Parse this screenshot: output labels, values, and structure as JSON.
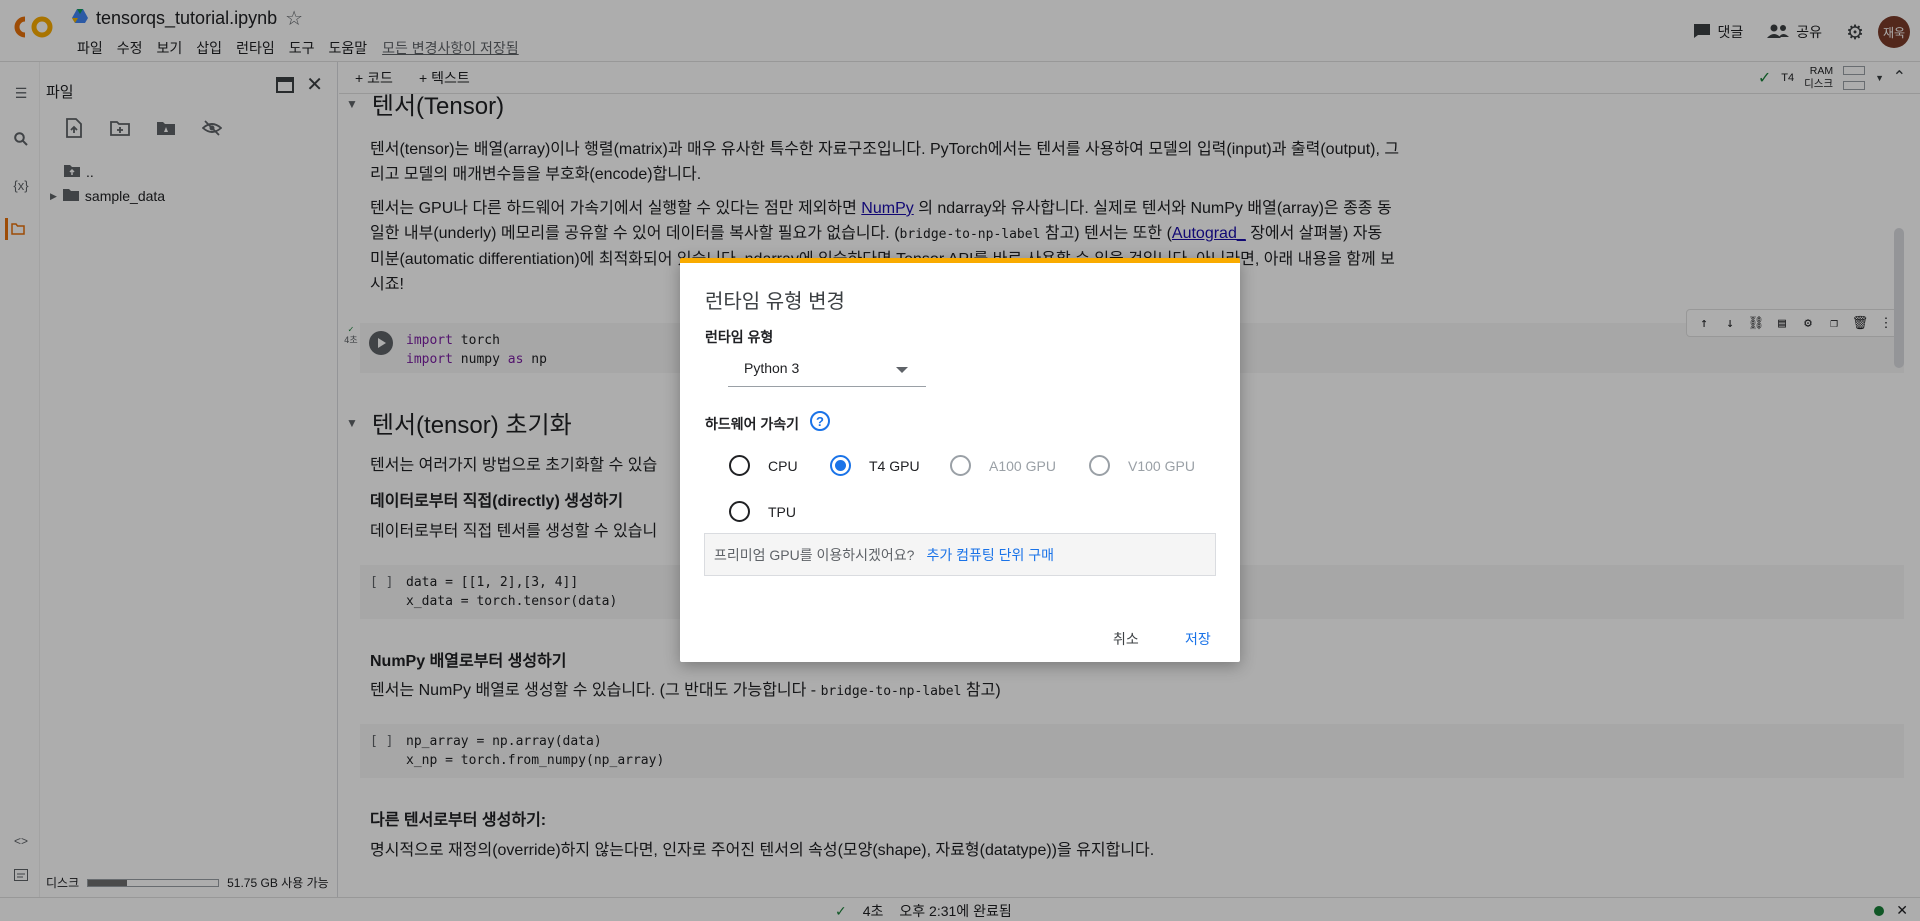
{
  "app": {
    "file_name": "tensorqs_tutorial.ipynb",
    "logo_text": "CO",
    "menu": [
      "파일",
      "수정",
      "보기",
      "삽입",
      "런타임",
      "도구",
      "도움말"
    ],
    "saved_status": "모든 변경사항이 저장됨",
    "comment_label": "댓글",
    "share_label": "공유",
    "avatar_text": "재욱"
  },
  "files_panel": {
    "title": "파일",
    "tree": [
      {
        "label": ".."
      },
      {
        "label": "sample_data"
      }
    ],
    "disk_label": "디스크",
    "disk_free": "51.75 GB 사용 가능",
    "disk_used_fraction": 0.3
  },
  "toolbar": {
    "add_code": "+ 코드",
    "add_text": "+ 텍스트",
    "runtime_type": "T4",
    "ram_label": "RAM",
    "disk_label": "디스크"
  },
  "notebook": {
    "section1_title": "텐서(Tensor)",
    "p1": "텐서(tensor)는 배열(array)이나 행렬(matrix)과 매우 유사한 특수한 자료구조입니다. PyTorch에서는 텐서를 사용하여 모델의 입력(input)과 출력(output), 그리고 모델의 매개변수들을 부호화(encode)합니다.",
    "p2_a": "텐서는 GPU나 다른 하드웨어 가속기에서 실행할 수 있다는 점만 제외하면 ",
    "p2_link1": "NumPy",
    "p2_b": " 의 ndarray와 유사합니다. 실제로 텐서와 NumPy 배열(array)은 종종 동일한 내부(underly) 메모리를 공유할 수 있어 데이터를 복사할 필요가 없습니다. (",
    "p2_code": "bridge-to-np-label",
    "p2_c": " 참고) 텐서는 또한 (",
    "p2_link2": "Autograd_",
    "p2_d": " 장에서 살펴볼) 자동 미분(automatic differentiation)에 최적화되어 있습니다. ndarray에 익숙하다면 Tensor API를 바로 사용할 수 있을 것입니다. 아니라면, 아래 내용을 함께 보시죠!",
    "cell1_exec": "4초",
    "cell1_code": [
      "import torch",
      "import numpy as np"
    ],
    "section2_title": "텐서(tensor) 초기화",
    "p3": "텐서는 여러가지 방법으로 초기화할 수 있습",
    "h_direct": "데이터로부터 직접(directly) 생성하기",
    "p4": "데이터로부터 직접 텐서를 생성할 수 있습니",
    "cell2_bracket": "[ ]",
    "cell2_line1": "data = [[1, 2],[3, 4]]",
    "cell2_line2": "x_data = torch.tensor(data)",
    "h_numpy": "NumPy 배열로부터 생성하기",
    "p5_a": "텐서는 NumPy 배열로 생성할 수 있습니다. (그 반대도 가능합니다 - ",
    "p5_code": "bridge-to-np-label",
    "p5_b": " 참고)",
    "cell3_bracket": "[ ]",
    "cell3_line1": "np_array = np.array(data)",
    "cell3_line2": "x_np = torch.from_numpy(np_array)",
    "h_other": "다른 텐서로부터 생성하기:",
    "p6": "명시적으로 재정의(override)하지 않는다면, 인자로 주어진 텐서의 속성(모양(shape), 자료형(datatype))을 유지합니다."
  },
  "status_bar": {
    "elapsed": "4초",
    "completed": "오후 2:31에 완료됨"
  },
  "dialog": {
    "title": "런타임 유형 변경",
    "runtime_label": "런타임 유형",
    "runtime_value": "Python 3",
    "accel_label": "하드웨어 가속기",
    "options": [
      "CPU",
      "T4 GPU",
      "A100 GPU",
      "V100 GPU",
      "TPU"
    ],
    "selected": "T4 GPU",
    "premium_text": "프리미엄 GPU를 이용하시겠어요?",
    "premium_link": "추가 컴퓨팅 단위 구매",
    "cancel": "취소",
    "save": "저장"
  },
  "colors": {
    "accent": "#1a73e8",
    "dialog_top": "#f9ab00",
    "logo_orange": "#f9ab00",
    "logo_dark_orange": "#e8710a"
  }
}
